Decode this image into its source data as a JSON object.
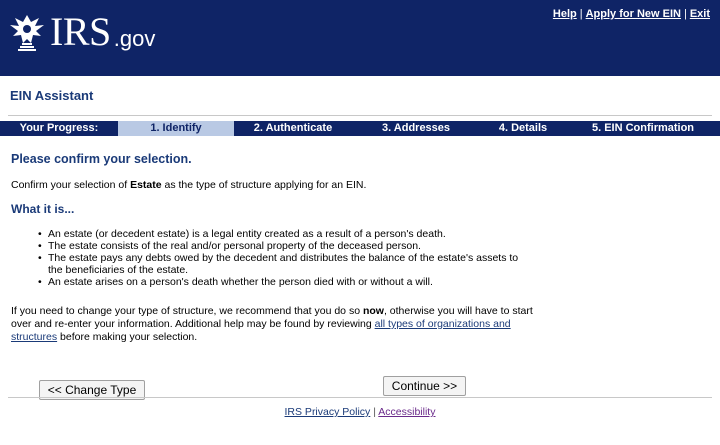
{
  "header": {
    "logo_main": "IRS",
    "logo_suffix": ".gov",
    "links": [
      "Help",
      "Apply for New EIN",
      "Exit"
    ],
    "separator": "|",
    "background": "#0f2466"
  },
  "app_title": "EIN Assistant",
  "progress": {
    "label": "Your Progress:",
    "steps": [
      "1. Identify",
      "2. Authenticate",
      "3. Addresses",
      "4. Details",
      "5. EIN Confirmation"
    ],
    "active_step": "1. Identify",
    "active_color": "#b9c9e4"
  },
  "main": {
    "heading": "Please confirm your selection.",
    "confirm_prefix": "Confirm your selection of ",
    "confirm_entity": "Estate",
    "confirm_suffix": " as the type of structure applying for an EIN.",
    "what_heading": "What it is...",
    "bullets": [
      "An estate (or decedent estate) is a legal entity created as a result of a person's death.",
      "The estate consists of the real and/or personal property of the deceased person.",
      "The estate pays any debts owed by the decedent and distributes the balance of the estate's assets to the beneficiaries of the estate.",
      "An estate arises on a person's death whether the person died with or without a will."
    ],
    "change_part1": "If you need to change your type of structure, we recommend that you do so ",
    "change_bold": "now",
    "change_part2": ", otherwise you will have to start over and re-enter your information.  Additional help may be found by reviewing ",
    "change_link": "all types of organizations and structures",
    "change_part3": " before making your selection."
  },
  "buttons": {
    "change_type": "<< Change Type",
    "continue": "Continue >>"
  },
  "footer": {
    "privacy": "IRS Privacy Policy",
    "separator": "|",
    "accessibility": "Accessibility"
  }
}
